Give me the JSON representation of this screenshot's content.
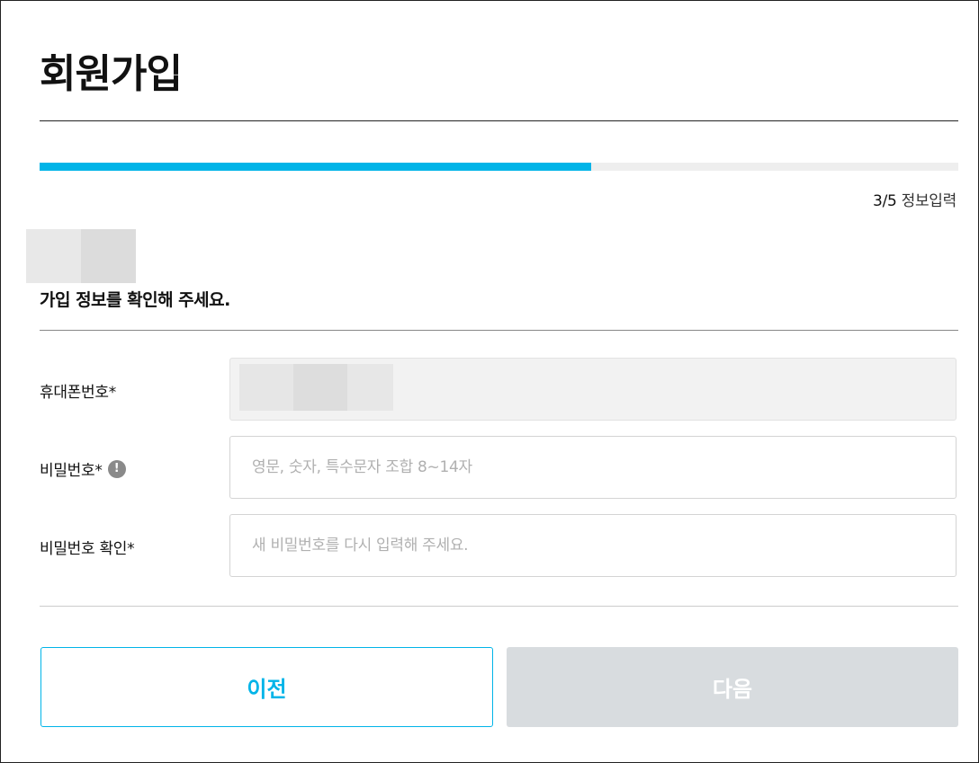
{
  "page": {
    "title": "회원가입"
  },
  "progress": {
    "value": 0.6,
    "step_number": "3/5",
    "step_label": "정보입력"
  },
  "section": {
    "heading": "가입 정보를 확인해 주세요."
  },
  "fields": {
    "phone": {
      "label": "휴대폰번호*"
    },
    "password": {
      "label": "비밀번호*",
      "info_icon": "!",
      "placeholder": "영문, 숫자, 특수문자 조합 8~14자"
    },
    "password_confirm": {
      "label": "비밀번호 확인*",
      "placeholder": "새 비밀번호를 다시 입력해 주세요."
    }
  },
  "buttons": {
    "prev_label": "이전",
    "next_label": "다음"
  },
  "colors": {
    "accent": "#00b4e8",
    "disabled_button": "#d8dcdf",
    "track": "#eeeeee"
  },
  "icons": {
    "password_info": "exclamation-circle-icon"
  }
}
